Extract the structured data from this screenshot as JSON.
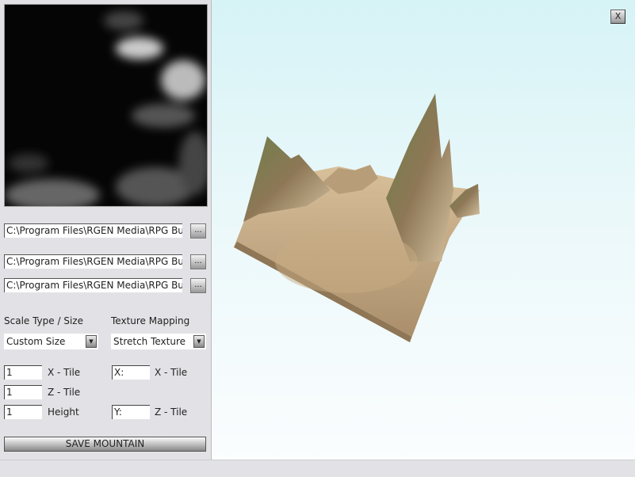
{
  "file_paths": [
    "C:\\Program Files\\RGEN Media\\RPG Bu",
    "C:\\Program Files\\RGEN Media\\RPG Bu",
    "C:\\Program Files\\RGEN Media\\RPG Bu"
  ],
  "browse_label": "...",
  "scale": {
    "label": "Scale Type / Size",
    "selected": "Custom Size"
  },
  "texture": {
    "label": "Texture Mapping",
    "selected": "Stretch Texture"
  },
  "fields": {
    "x_tile": {
      "value": "1",
      "label": "X - Tile"
    },
    "z_tile": {
      "value": "1",
      "label": "Z - Tile"
    },
    "height": {
      "value": "1",
      "label": "Height"
    },
    "tex_x": {
      "value": "X:",
      "label": "X - Tile"
    },
    "tex_y": {
      "value": "Y:",
      "label": "Z - Tile"
    }
  },
  "save_label": "SAVE MOUNTAIN",
  "close_label": "X"
}
